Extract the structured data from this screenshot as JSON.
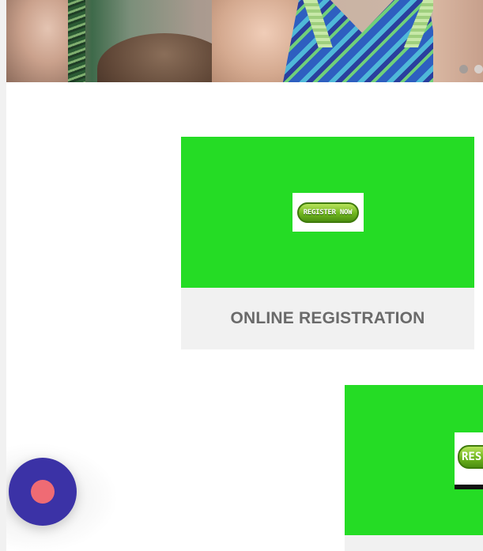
{
  "hero": {
    "slides": [
      {
        "active": false
      },
      {
        "active": true
      }
    ]
  },
  "cards": [
    {
      "button_text": "REGISTER NOW",
      "caption": "ONLINE REGISTRATION"
    },
    {
      "button_text": "RES",
      "caption": ""
    }
  ],
  "colors": {
    "card_green": "#25dc25",
    "caption_bg": "#f1f1f1",
    "caption_text": "#6a6a6a",
    "fab_bg": "#3b32a6",
    "fab_dot": "#ef6b74"
  },
  "icons": {
    "fab": "record-dot-icon"
  }
}
